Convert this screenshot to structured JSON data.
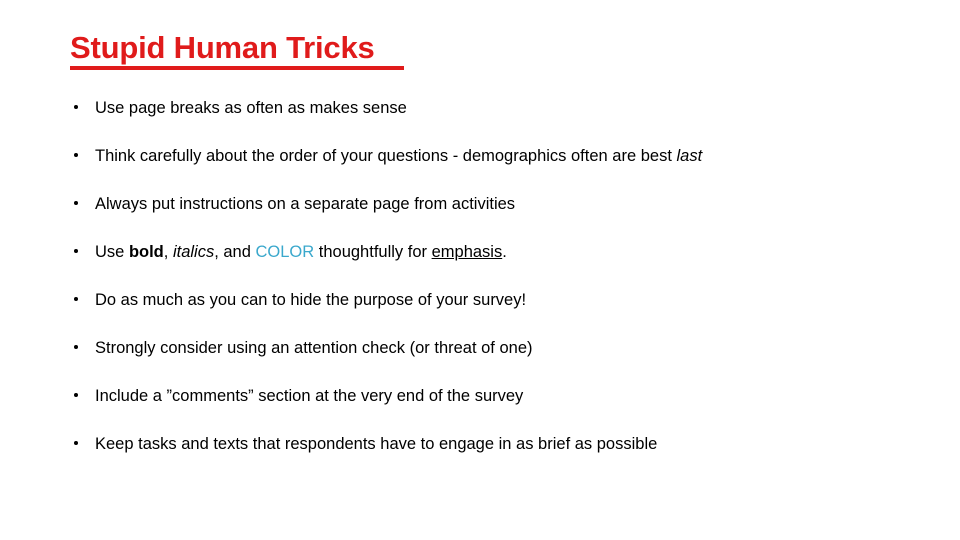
{
  "slide": {
    "title": "Stupid Human Tricks",
    "title_color": "#e01b1b",
    "background_color": "#ffffff",
    "body_text_color": "#000000",
    "accent_color": "#3aa8cc",
    "bullets": [
      {
        "id": "page-breaks",
        "text": "Use page breaks as often as makes sense"
      },
      {
        "id": "question-order",
        "lead": "Think carefully about the order of your questions - demographics often are best ",
        "italic": "last",
        "trail": ""
      },
      {
        "id": "instructions-separate-page",
        "text": "Always put instructions on a separate page from activities"
      },
      {
        "id": "formatting-emphasis",
        "part1": "Use ",
        "bold": "bold",
        "part2": ", ",
        "italic": "italics",
        "part3": ", and ",
        "color_word": "COLOR",
        "part4": " thoughtfully for ",
        "underlined": "emphasis",
        "part5": "."
      },
      {
        "id": "hide-purpose",
        "text": "Do as much as you can to hide the purpose of your survey!"
      },
      {
        "id": "attention-check",
        "text": "Strongly consider using an attention check (or threat of one)"
      },
      {
        "id": "comments-section",
        "text": "Include a ”comments” section at the very end of the survey"
      },
      {
        "id": "brief-tasks",
        "text": "Keep tasks and texts that respondents have to engage in as brief as possible"
      }
    ]
  }
}
